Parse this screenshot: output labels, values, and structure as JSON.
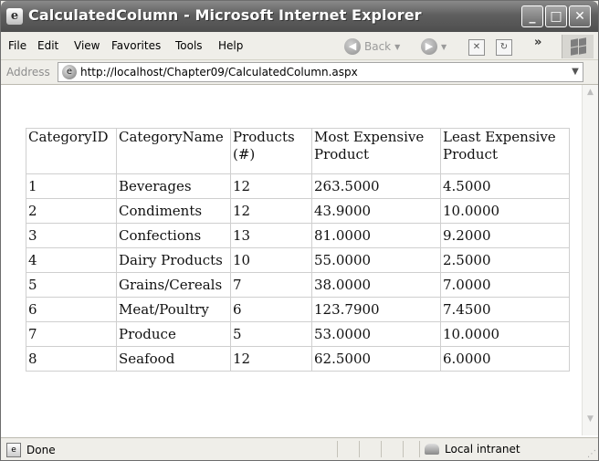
{
  "window": {
    "title": "CalculatedColumn - Microsoft Internet Explorer",
    "controls": {
      "minimize": "_",
      "maximize": "□",
      "close": "✕"
    }
  },
  "menu": {
    "items": [
      "File",
      "Edit",
      "View",
      "Favorites",
      "Tools",
      "Help"
    ]
  },
  "toolbar": {
    "back_label": "Back",
    "chevrons": "»"
  },
  "address": {
    "label": "Address",
    "url": "http://localhost/Chapter09/CalculatedColumn.aspx"
  },
  "table": {
    "headers": [
      "CategoryID",
      "CategoryName",
      "Products (#)",
      "Most Expensive Product",
      "Least Expensive Product"
    ],
    "rows": [
      [
        "1",
        "Beverages",
        "12",
        "263.5000",
        "4.5000"
      ],
      [
        "2",
        "Condiments",
        "12",
        "43.9000",
        "10.0000"
      ],
      [
        "3",
        "Confections",
        "13",
        "81.0000",
        "9.2000"
      ],
      [
        "4",
        "Dairy Products",
        "10",
        "55.0000",
        "2.5000"
      ],
      [
        "5",
        "Grains/Cereals",
        "7",
        "38.0000",
        "7.0000"
      ],
      [
        "6",
        "Meat/Poultry",
        "6",
        "123.7900",
        "7.4500"
      ],
      [
        "7",
        "Produce",
        "5",
        "53.0000",
        "10.0000"
      ],
      [
        "8",
        "Seafood",
        "12",
        "62.5000",
        "6.0000"
      ]
    ]
  },
  "status": {
    "text": "Done",
    "zone": "Local intranet"
  }
}
